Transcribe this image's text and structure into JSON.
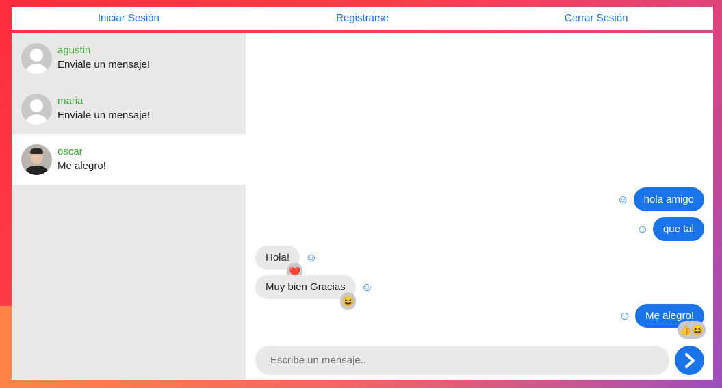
{
  "nav": {
    "login": "Iniciar Sesión",
    "register": "Registrarse",
    "logout": "Cerrar Sesión"
  },
  "contacts": [
    {
      "name": "agustin",
      "preview": "Enviale un mensaje!",
      "avatar": "default-avatar"
    },
    {
      "name": "maria",
      "preview": "Enviale un mensaje!",
      "avatar": "default-avatar"
    },
    {
      "name": "oscar",
      "preview": "Me alegro!",
      "avatar": "photo",
      "active": true
    }
  ],
  "messages": [
    {
      "from": "me",
      "text": "hola amigo",
      "reaction": ""
    },
    {
      "from": "me",
      "text": "que tal",
      "reaction": ""
    },
    {
      "from": "them",
      "text": "Hola!",
      "reaction": "❤️"
    },
    {
      "from": "them",
      "text": "Muy bien Gracias",
      "reaction": "😆"
    },
    {
      "from": "me",
      "text": "Me alegro!",
      "reaction": "👍😆"
    }
  ],
  "composer": {
    "placeholder": "Escribe un mensaje.."
  },
  "icons": {
    "react": "smile-icon",
    "send": "chevron-right-icon"
  },
  "colors": {
    "accent": "#1a73e8",
    "contact_name": "#3aaa35",
    "bubble_in": "#ebe9e7"
  }
}
